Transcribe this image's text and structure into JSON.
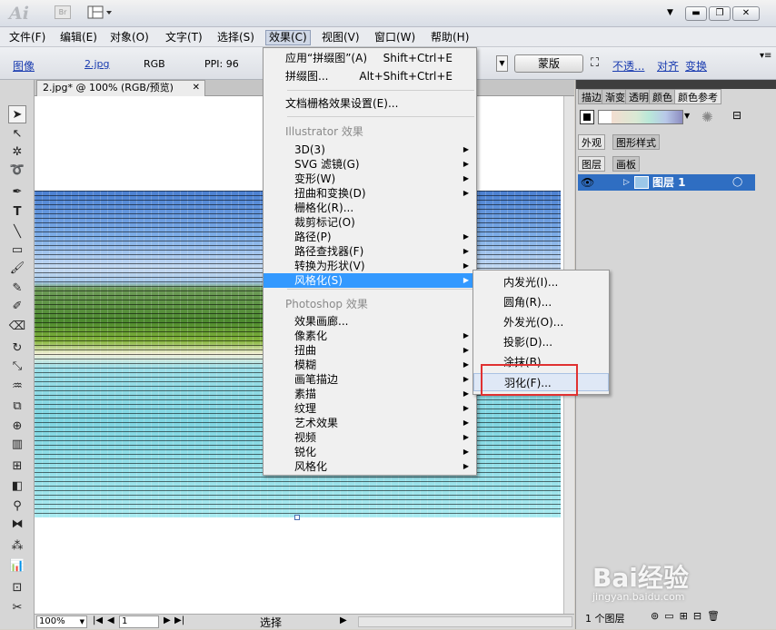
{
  "app": {
    "logo": "Ai",
    "br_label": "Br"
  },
  "menubar": [
    "文件(F)",
    "编辑(E)",
    "对象(O)",
    "文字(T)",
    "选择(S)",
    "效果(C)",
    "视图(V)",
    "窗口(W)",
    "帮助(H)"
  ],
  "controlbar": {
    "image_label": "图像",
    "filename": "2.jpg",
    "mode": "RGB",
    "ppi": "PPI: 96",
    "mask_label": "蒙版",
    "opacity_link": "不透...",
    "align_link": "对齐",
    "transform_link": "变换"
  },
  "document": {
    "tab_title": "2.jpg* @ 100% (RGB/预览)"
  },
  "status": {
    "zoom": "100%",
    "page": "1",
    "tool": "选择"
  },
  "effect_menu": {
    "apply": {
      "label": "应用“拼缀图”(A)",
      "shortcut": "Shift+Ctrl+E"
    },
    "last": {
      "label": "拼缀图...",
      "shortcut": "Alt+Shift+Ctrl+E"
    },
    "raster_settings": "文档栅格效果设置(E)...",
    "illustrator_header": "Illustrator 效果",
    "illustrator_items": [
      "3D(3)",
      "SVG 滤镜(G)",
      "变形(W)",
      "扭曲和变换(D)",
      "栅格化(R)...",
      "裁剪标记(O)",
      "路径(P)",
      "路径查找器(F)",
      "转换为形状(V)",
      "风格化(S)"
    ],
    "photoshop_header": "Photoshop 效果",
    "photoshop_items": [
      "效果画廊...",
      "像素化",
      "扭曲",
      "模糊",
      "画笔描边",
      "素描",
      "纹理",
      "艺术效果",
      "视频",
      "锐化",
      "风格化"
    ]
  },
  "stylize_submenu": [
    "内发光(I)...",
    "圆角(R)...",
    "外发光(O)...",
    "投影(D)...",
    "涂抹(B)...",
    "羽化(F)..."
  ],
  "panels": {
    "top_tabs": [
      "描边",
      "渐变",
      "透明",
      "颜色",
      "颜色参考"
    ],
    "mid_tabs": [
      "外观",
      "图形样式"
    ],
    "layer_tabs": [
      "图层",
      "画板"
    ],
    "layer_name": "图层 1",
    "layer_count": "1 个图层"
  },
  "watermark": {
    "text": "Bai经验",
    "sub": "jingyan.baidu.com"
  },
  "colors": {
    "highlight": "#3399ff",
    "red_box": "#e03131",
    "layer_selected": "#2f6ec2"
  }
}
